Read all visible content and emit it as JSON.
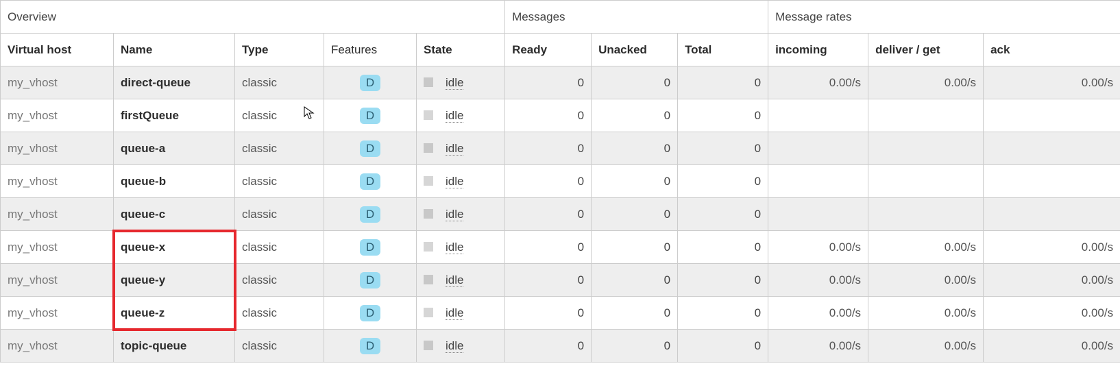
{
  "header_groups": {
    "overview": "Overview",
    "messages": "Messages",
    "rates": "Message rates"
  },
  "columns": {
    "vhost": "Virtual host",
    "name": "Name",
    "type": "Type",
    "features": "Features",
    "state": "State",
    "ready": "Ready",
    "unacked": "Unacked",
    "total": "Total",
    "incoming": "incoming",
    "deliver_get": "deliver / get",
    "ack": "ack"
  },
  "feature_badge_label": "D",
  "rows": [
    {
      "vhost": "my_vhost",
      "name": "direct-queue",
      "type": "classic",
      "state": "idle",
      "ready": "0",
      "unacked": "0",
      "total": "0",
      "incoming": "0.00/s",
      "deliver_get": "0.00/s",
      "ack": "0.00/s"
    },
    {
      "vhost": "my_vhost",
      "name": "firstQueue",
      "type": "classic",
      "state": "idle",
      "ready": "0",
      "unacked": "0",
      "total": "0",
      "incoming": "",
      "deliver_get": "",
      "ack": ""
    },
    {
      "vhost": "my_vhost",
      "name": "queue-a",
      "type": "classic",
      "state": "idle",
      "ready": "0",
      "unacked": "0",
      "total": "0",
      "incoming": "",
      "deliver_get": "",
      "ack": ""
    },
    {
      "vhost": "my_vhost",
      "name": "queue-b",
      "type": "classic",
      "state": "idle",
      "ready": "0",
      "unacked": "0",
      "total": "0",
      "incoming": "",
      "deliver_get": "",
      "ack": ""
    },
    {
      "vhost": "my_vhost",
      "name": "queue-c",
      "type": "classic",
      "state": "idle",
      "ready": "0",
      "unacked": "0",
      "total": "0",
      "incoming": "",
      "deliver_get": "",
      "ack": ""
    },
    {
      "vhost": "my_vhost",
      "name": "queue-x",
      "type": "classic",
      "state": "idle",
      "ready": "0",
      "unacked": "0",
      "total": "0",
      "incoming": "0.00/s",
      "deliver_get": "0.00/s",
      "ack": "0.00/s"
    },
    {
      "vhost": "my_vhost",
      "name": "queue-y",
      "type": "classic",
      "state": "idle",
      "ready": "0",
      "unacked": "0",
      "total": "0",
      "incoming": "0.00/s",
      "deliver_get": "0.00/s",
      "ack": "0.00/s"
    },
    {
      "vhost": "my_vhost",
      "name": "queue-z",
      "type": "classic",
      "state": "idle",
      "ready": "0",
      "unacked": "0",
      "total": "0",
      "incoming": "0.00/s",
      "deliver_get": "0.00/s",
      "ack": "0.00/s"
    },
    {
      "vhost": "my_vhost",
      "name": "topic-queue",
      "type": "classic",
      "state": "idle",
      "ready": "0",
      "unacked": "0",
      "total": "0",
      "incoming": "0.00/s",
      "deliver_get": "0.00/s",
      "ack": "0.00/s"
    }
  ],
  "highlight_range": {
    "start": 5,
    "end": 7
  },
  "cursor_row": 1
}
